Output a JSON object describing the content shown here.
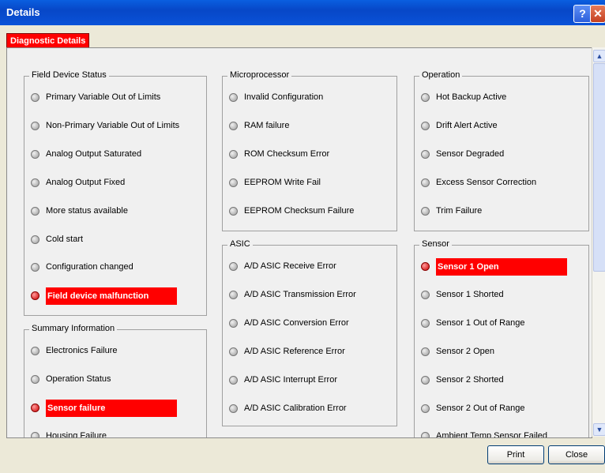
{
  "window": {
    "title": "Details",
    "help_glyph": "?",
    "close_glyph": "✕"
  },
  "tab": {
    "label": "Diagnostic Details"
  },
  "groups": {
    "field_device_status": {
      "label": "Field Device Status",
      "items": [
        {
          "label": "Primary Variable Out of Limits",
          "active": false
        },
        {
          "label": "Non-Primary Variable Out of Limits",
          "active": false
        },
        {
          "label": "Analog Output Saturated",
          "active": false
        },
        {
          "label": "Analog Output Fixed",
          "active": false
        },
        {
          "label": "More status available",
          "active": false
        },
        {
          "label": "Cold start",
          "active": false
        },
        {
          "label": "Configuration changed",
          "active": false
        },
        {
          "label": "Field device malfunction",
          "active": true
        }
      ]
    },
    "summary_information": {
      "label": "Summary Information",
      "items": [
        {
          "label": "Electronics Failure",
          "active": false
        },
        {
          "label": "Operation Status",
          "active": false
        },
        {
          "label": "Sensor failure",
          "active": true
        },
        {
          "label": "Housing Failure",
          "active": false
        }
      ]
    },
    "microprocessor": {
      "label": "Microprocessor",
      "items": [
        {
          "label": "Invalid Configuration",
          "active": false
        },
        {
          "label": "RAM failure",
          "active": false
        },
        {
          "label": "ROM Checksum Error",
          "active": false
        },
        {
          "label": "EEPROM Write Fail",
          "active": false
        },
        {
          "label": "EEPROM Checksum Failure",
          "active": false
        }
      ]
    },
    "asic": {
      "label": "ASIC",
      "items": [
        {
          "label": "A/D ASIC Receive Error",
          "active": false
        },
        {
          "label": "A/D ASIC Transmission Error",
          "active": false
        },
        {
          "label": "A/D ASIC Conversion Error",
          "active": false
        },
        {
          "label": "A/D ASIC Reference Error",
          "active": false
        },
        {
          "label": "A/D ASIC Interrupt Error",
          "active": false
        },
        {
          "label": "A/D ASIC Calibration Error",
          "active": false
        }
      ]
    },
    "operation": {
      "label": "Operation",
      "items": [
        {
          "label": "Hot Backup Active",
          "active": false
        },
        {
          "label": "Drift Alert Active",
          "active": false
        },
        {
          "label": "Sensor Degraded",
          "active": false
        },
        {
          "label": "Excess Sensor Correction",
          "active": false
        },
        {
          "label": "Trim Failure",
          "active": false
        }
      ]
    },
    "sensor": {
      "label": "Sensor",
      "items": [
        {
          "label": "Sensor 1  Open",
          "active": true
        },
        {
          "label": "Sensor 1 Shorted",
          "active": false
        },
        {
          "label": "Sensor 1 Out of Range",
          "active": false
        },
        {
          "label": "Sensor 2 Open",
          "active": false
        },
        {
          "label": "Sensor 2 Shorted",
          "active": false
        },
        {
          "label": "Sensor 2 Out of Range",
          "active": false
        },
        {
          "label": "Ambient Temp Sensor Failed",
          "active": false
        }
      ]
    }
  },
  "scrollbar": {
    "up_glyph": "▲",
    "down_glyph": "▼"
  },
  "footer": {
    "print_label": "Print",
    "close_label": "Close"
  },
  "colors": {
    "alert": "#ff0000",
    "titlebar": "#0a52d8"
  }
}
